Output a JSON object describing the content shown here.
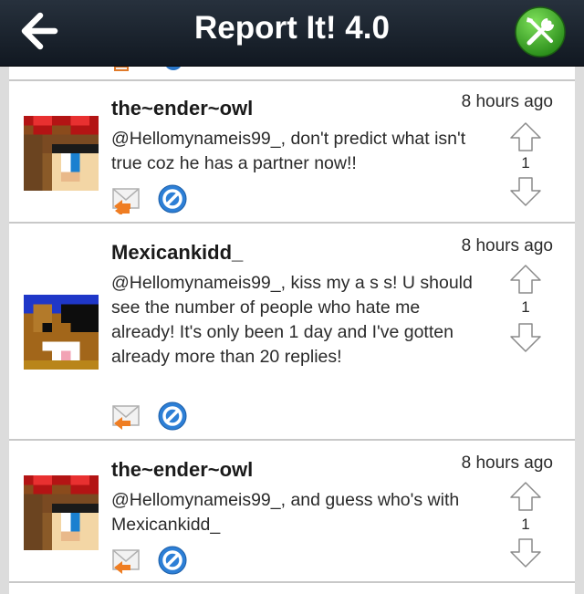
{
  "nav": {
    "title": "Report It! 4.0",
    "back_icon": "back-arrow-icon",
    "settings_icon": "wrench-screwdriver-icon",
    "settings_color": "#3fae2a"
  },
  "posts": [
    {
      "username": "the~ender~owl",
      "time": "8 hours ago",
      "message": "@Hellomynameis99_, don't predict what isn't true coz he has a partner now!!",
      "votes": "1"
    },
    {
      "username": "Mexicankidd_",
      "time": "8 hours ago",
      "message": "@Hellomynameis99_, kiss my a s s! U should see the number of people who hate me already! It's only been 1 day and I've gotten already more than 20 replies!",
      "votes": "1"
    },
    {
      "username": "the~ender~owl",
      "time": "8 hours ago",
      "message": "@Hellomynameis99_, and guess who's with Mexicankidd_",
      "votes": "1"
    }
  ]
}
